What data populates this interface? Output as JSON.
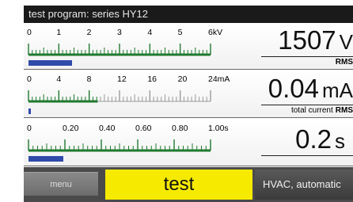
{
  "title": "test program:  series HY12",
  "meters": [
    {
      "id": "voltage",
      "ticks": [
        "0",
        "1",
        "2",
        "3",
        "4",
        "5",
        "6kV"
      ],
      "minor_per_major": 4,
      "fill_fraction": 1.0,
      "level_fraction": 0.25,
      "value": "1507",
      "unit": "V",
      "sub_left": "",
      "sub_right": "RMS"
    },
    {
      "id": "current",
      "ticks": [
        "0",
        "4",
        "8",
        "12",
        "16",
        "20",
        "24mA"
      ],
      "minor_per_major": 4,
      "fill_fraction": 0.38,
      "level_fraction": 0.01,
      "value": "0.04",
      "unit": "mA",
      "sub_left": "total current",
      "sub_right": "RMS"
    },
    {
      "id": "time",
      "ticks": [
        "0",
        "0.20",
        "0.40",
        "0.60",
        "0.80",
        "1.00s"
      ],
      "minor_per_major": 4,
      "fill_fraction": 1.0,
      "level_fraction": 0.2,
      "value": "0.2",
      "unit": "s",
      "sub_left": "",
      "sub_right": ""
    }
  ],
  "bottom": {
    "menu_label": "menu",
    "test_label": "test",
    "mode_label": "HVAC, automatic"
  },
  "colors": {
    "scale_fill": "#1f7a2e",
    "scale_empty": "#9a9a9a",
    "level_bar": "#2f4aa9",
    "test_button": "#f6ea00",
    "titlebar": "#1a1a1a"
  }
}
